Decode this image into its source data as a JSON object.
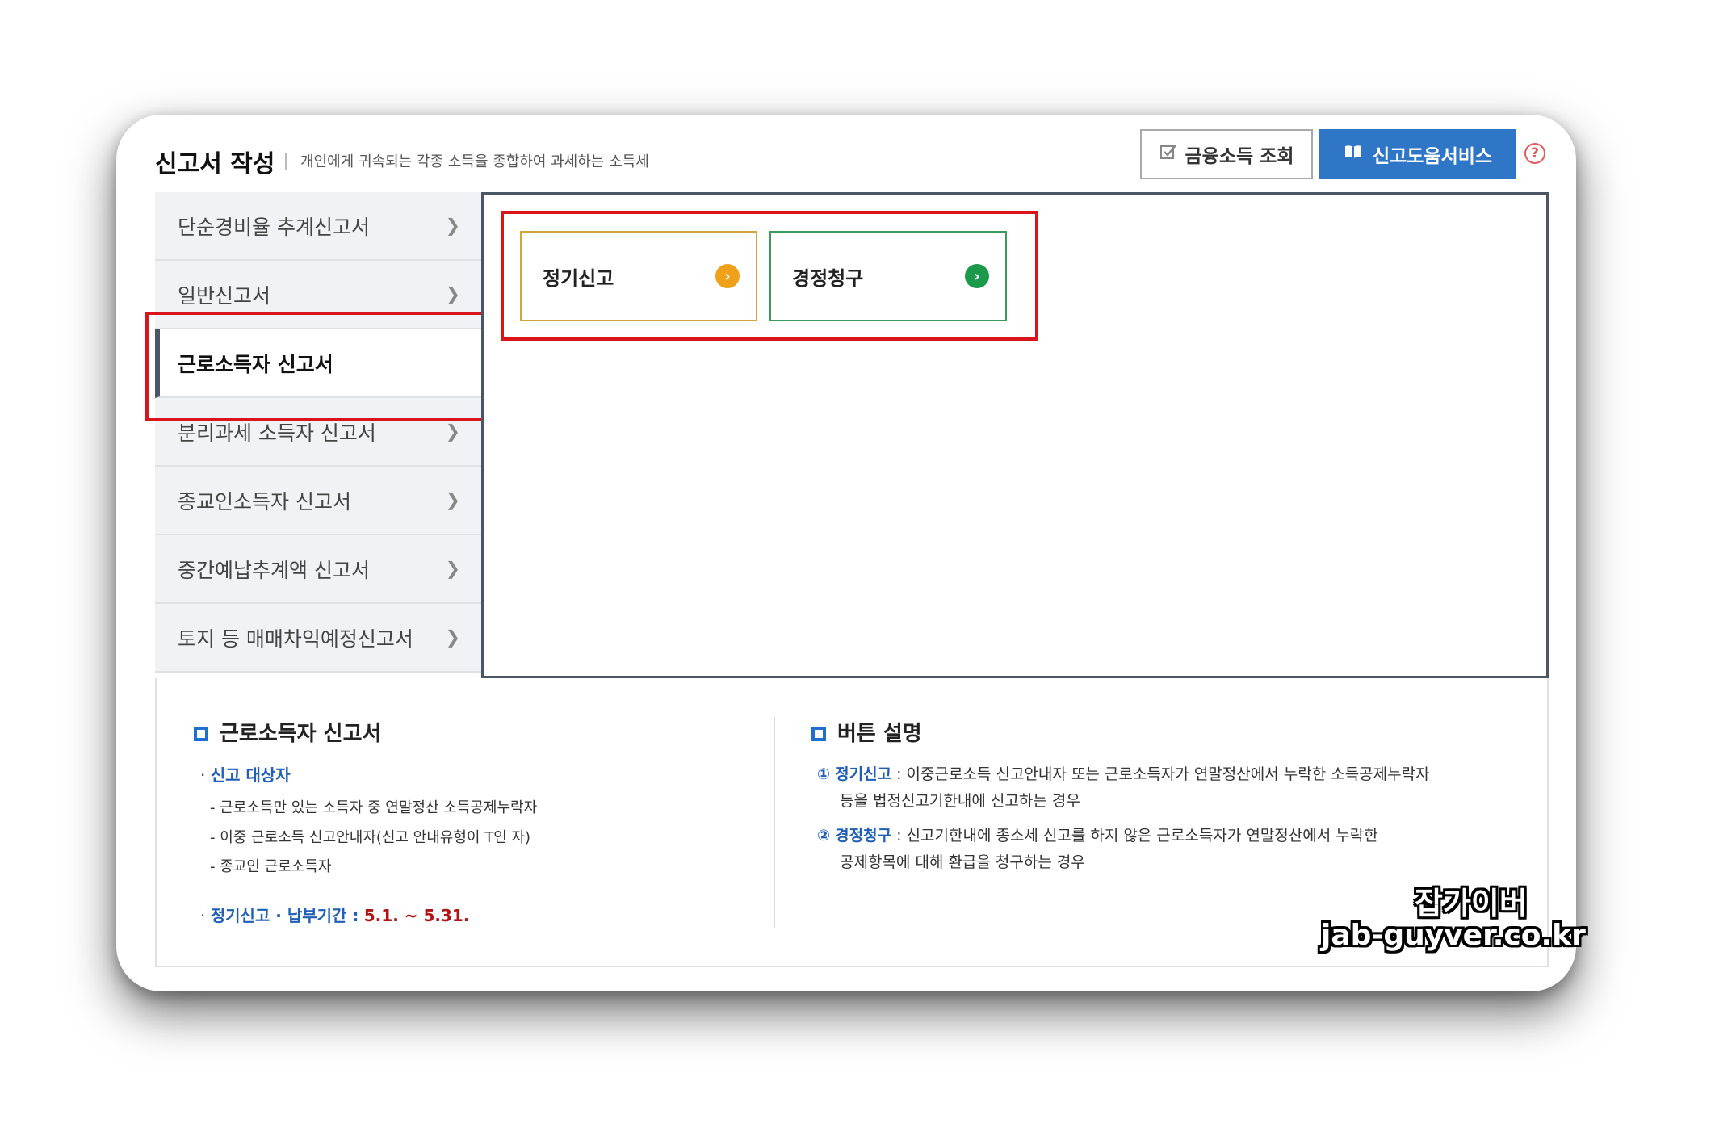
{
  "header": {
    "title": "신고서 작성",
    "description": "개인에게 귀속되는 각종 소득을 종합하여 과세하는 소득세",
    "financial_income_button": "금융소득 조회",
    "help_service_button": "신고도움서비스",
    "help_icon": "?"
  },
  "sidebar": {
    "items": [
      {
        "label": "단순경비율 추계신고서"
      },
      {
        "label": "일반신고서"
      },
      {
        "label": "근로소득자 신고서"
      },
      {
        "label": "분리과세 소득자 신고서"
      },
      {
        "label": "종교인소득자 신고서"
      },
      {
        "label": "중간예납추계액 신고서"
      },
      {
        "label": "토지 등 매매차익예정신고서"
      }
    ],
    "active_index": 2
  },
  "options": [
    {
      "label": "정기신고",
      "color": "#f0a11b",
      "border": "#d4a53a"
    },
    {
      "label": "경정청구",
      "color": "#1a9a4a",
      "border": "#3c9a5e"
    }
  ],
  "info_left": {
    "title": "근로소득자 신고서",
    "target_label": "신고 대상자",
    "targets": [
      "- 근로소득만 있는 소득자 중 연말정산 소득공제누락자",
      "- 이중 근로소득 신고안내자(신고 안내유형이 T인 자)",
      "- 종교인 근로소득자"
    ],
    "period_label": "정기신고 · 납부기간 :",
    "period_value": "5.1. ~ 5.31."
  },
  "info_right": {
    "title": "버튼 설명",
    "items": [
      {
        "num": "①",
        "term": "정기신고",
        "line1": " : 이중근로소득 신고안내자 또는 근로소득자가 연말정산에서 누락한 소득공제누락자",
        "line2": "등을 법정신고기한내에 신고하는 경우"
      },
      {
        "num": "②",
        "term": "경정청구",
        "line1": " : 신고기한내에 종소세 신고를 하지 않은 근로소득자가 연말정산에서 누락한",
        "line2": "공제항목에 대해 환급을 청구하는 경우"
      }
    ]
  },
  "watermark": {
    "line1": "잡가이버",
    "line2": "jab-guyver.co.kr"
  },
  "colors": {
    "accent_blue": "#2f77c6",
    "highlight_red": "#d9141b",
    "label_blue": "#1f5fb5",
    "period_red": "#b01515"
  }
}
